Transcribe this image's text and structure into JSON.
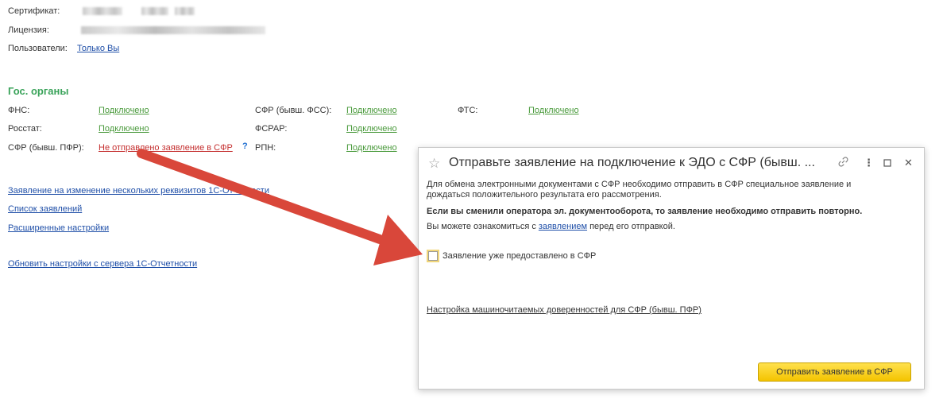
{
  "top": {
    "certificate_label": "Сертификат:",
    "license_label": "Лицензия:",
    "users_label": "Пользователи:",
    "users_link": "Только Вы"
  },
  "gov": {
    "title": "Гос. органы",
    "fns_label": "ФНС:",
    "fns_status": "Подключено",
    "rosstat_label": "Росстат:",
    "rosstat_status": "Подключено",
    "sfr_pfr_label": "СФР (бывш. ПФР):",
    "sfr_pfr_status": "Не отправлено заявление в СФР",
    "help": "?",
    "sfr_fss_label": "СФР (бывш. ФСС):",
    "sfr_fss_status": "Подключено",
    "fsrar_label": "ФСРАР:",
    "fsrar_status": "Подключено",
    "rpn_label": "РПН:",
    "rpn_status": "Подключено",
    "fts_label": "ФТС:",
    "fts_status": "Подключено"
  },
  "links": {
    "change_requisites": "Заявление на изменение нескольких реквизитов 1С-Отчетности",
    "applications_list": "Список заявлений",
    "advanced_settings": "Расширенные настройки",
    "update_settings": "Обновить настройки с сервера 1С-Отчетности"
  },
  "dialog": {
    "title": "Отправьте заявление на подключение к ЭДО с СФР (бывш. ...",
    "para1_line1": "Для обмена электронными документами с СФР необходимо отправить в СФР специальное заявление и",
    "para1_line2": "дождаться положительного результата его рассмотрения.",
    "para2": "Если вы сменили оператора эл. документооборота, то заявление необходимо отправить повторно.",
    "para3_before": "Вы можете ознакомиться с ",
    "para3_link": "заявлением",
    "para3_after": " перед его отправкой.",
    "checkbox_label": "Заявление уже предоставлено в СФР",
    "poa_link": "Настройка машиночитаемых доверенностей для СФР (бывш. ПФР)",
    "send_button": "Отправить заявление в СФР",
    "icons": [
      "star-icon",
      "link-icon",
      "more-icon",
      "maximize-icon",
      "close-icon"
    ]
  },
  "colors": {
    "section_title": "#3aa35a",
    "link_green": "#4a9a3c",
    "link_red": "#c53030",
    "link_blue": "#1f4fa8",
    "button_yellow": "#f4c400",
    "arrow": "#d9473a"
  }
}
